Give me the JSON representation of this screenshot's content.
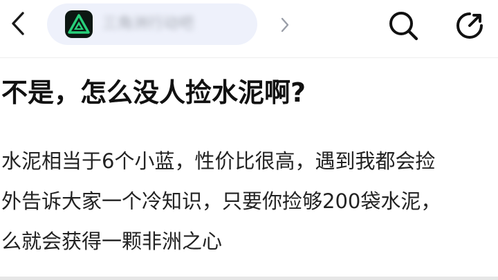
{
  "header": {
    "back_icon": "chevron-left-icon",
    "forum": {
      "logo_icon": "triangle-logo-icon",
      "name": "三角洲行动吧",
      "chevron_icon": "chevron-right-icon"
    },
    "search_icon": "search-icon",
    "share_icon": "share-icon"
  },
  "post": {
    "title": "不是，怎么没人捡水泥啊?",
    "body_lines": [
      "水泥相当于6个小蓝，性价比很高，遇到我都会捡",
      "外告诉大家一个冷知识，只要你捡够200袋水泥，",
      "么就会获得一颗非洲之心"
    ]
  },
  "colors": {
    "logo_green": "#27d07a",
    "logo_background": "#0c1712",
    "pill_background": "#eef1fb",
    "title_text": "#111111"
  }
}
